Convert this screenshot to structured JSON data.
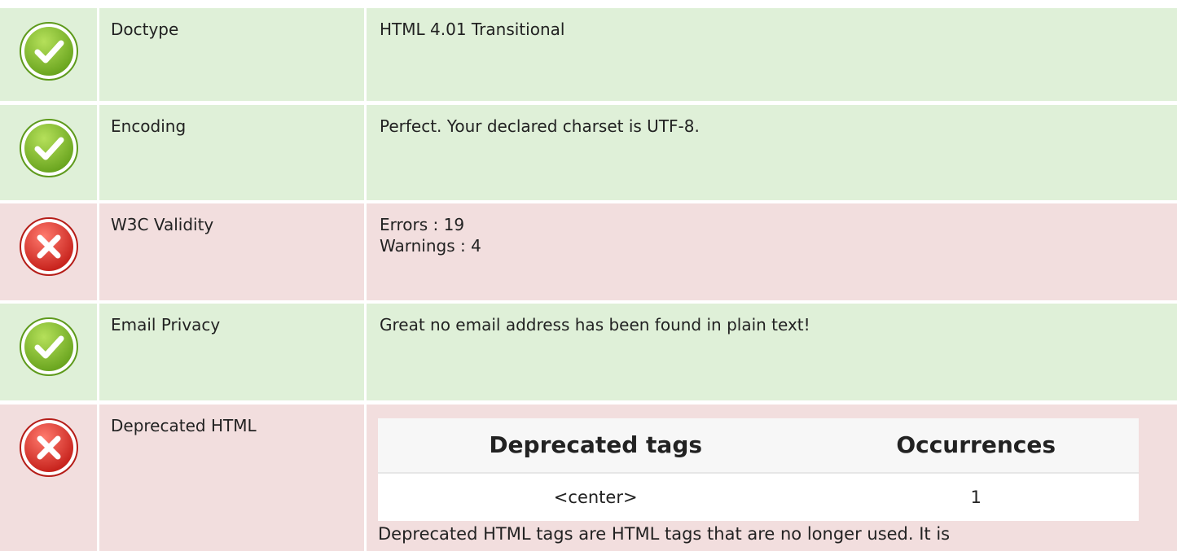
{
  "rows": [
    {
      "status": "pass",
      "icon": "check-circle-icon",
      "label": "Doctype",
      "value": "HTML 4.01 Transitional"
    },
    {
      "status": "pass",
      "icon": "check-circle-icon",
      "label": "Encoding",
      "value": "Perfect. Your declared charset is UTF-8."
    },
    {
      "status": "fail",
      "icon": "cross-circle-icon",
      "label": "W3C Validity",
      "value_lines": [
        "Errors : 19",
        "Warnings : 4"
      ]
    },
    {
      "status": "pass",
      "icon": "check-circle-icon",
      "label": "Email Privacy",
      "value": "Great no email address has been found in plain text!"
    },
    {
      "status": "fail",
      "icon": "cross-circle-icon",
      "label": "Deprecated HTML",
      "table": {
        "headers": [
          "Deprecated tags",
          "Occurrences"
        ],
        "rows": [
          [
            "<center>",
            "1"
          ]
        ]
      },
      "note": "Deprecated HTML tags are HTML tags that are no longer used. It is"
    }
  ],
  "colors": {
    "pass_bg": "#dff0d8",
    "fail_bg": "#f2dede",
    "pass_icon": "#8cc63f",
    "fail_icon": "#e8403a"
  }
}
